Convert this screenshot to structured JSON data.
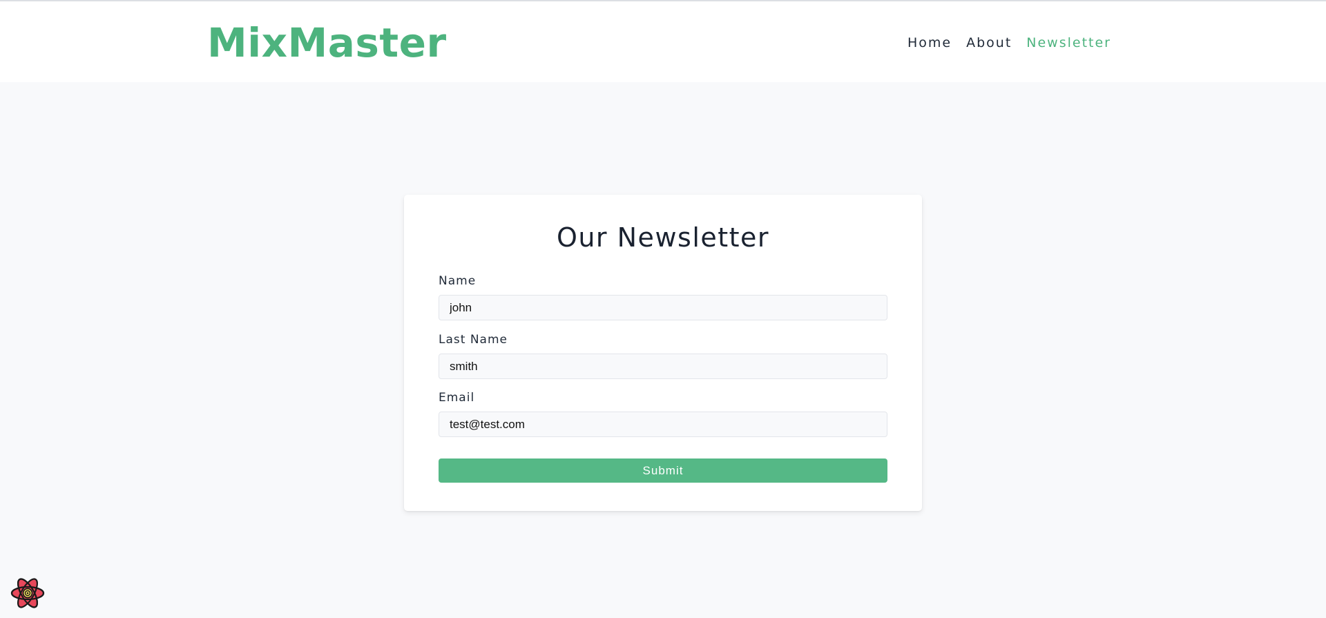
{
  "brand": {
    "logo_text": "MixMaster",
    "accent_color": "#4db37e"
  },
  "nav": {
    "items": [
      {
        "label": "Home",
        "active": false
      },
      {
        "label": "About",
        "active": false
      },
      {
        "label": "Newsletter",
        "active": true
      }
    ]
  },
  "form": {
    "title": "Our Newsletter",
    "fields": [
      {
        "label": "Name",
        "value": "john"
      },
      {
        "label": "Last Name",
        "value": "smith"
      },
      {
        "label": "Email",
        "value": "test@test.com"
      }
    ],
    "submit_label": "Submit",
    "submit_color": "#55b886"
  },
  "devtools": {
    "icon": "react-devtools-icon"
  }
}
